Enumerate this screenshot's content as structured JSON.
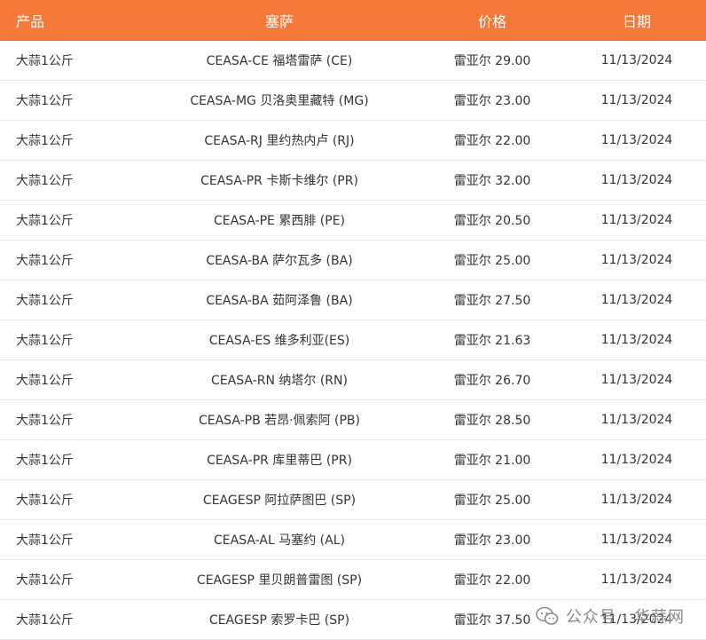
{
  "table": {
    "headers": [
      "产品",
      "塞萨",
      "价格",
      "日期"
    ],
    "rows": [
      [
        "大蒜1公斤",
        "CEASA-CE 福塔雷萨 (CE)",
        "雷亚尔 29.00",
        "11/13/2024"
      ],
      [
        "大蒜1公斤",
        "CEASA-MG 贝洛奥里藏特 (MG)",
        "雷亚尔 23.00",
        "11/13/2024"
      ],
      [
        "大蒜1公斤",
        "CEASA-RJ 里约热内卢 (RJ)",
        "雷亚尔 22.00",
        "11/13/2024"
      ],
      [
        "大蒜1公斤",
        "CEASA-PR 卡斯卡维尔 (PR)",
        "雷亚尔 32.00",
        "11/13/2024"
      ],
      [
        "大蒜1公斤",
        "CEASA-PE 累西腓 (PE)",
        "雷亚尔 20.50",
        "11/13/2024"
      ],
      [
        "大蒜1公斤",
        "CEASA-BA 萨尔瓦多 (BA)",
        "雷亚尔 25.00",
        "11/13/2024"
      ],
      [
        "大蒜1公斤",
        "CEASA-BA 茹阿泽鲁 (BA)",
        "雷亚尔 27.50",
        "11/13/2024"
      ],
      [
        "大蒜1公斤",
        "CEASA-ES 维多利亚(ES)",
        "雷亚尔 21.63",
        "11/13/2024"
      ],
      [
        "大蒜1公斤",
        "CEASA-RN 纳塔尔 (RN)",
        "雷亚尔 26.70",
        "11/13/2024"
      ],
      [
        "大蒜1公斤",
        "CEASA-PB 若昂·佩索阿 (PB)",
        "雷亚尔 28.50",
        "11/13/2024"
      ],
      [
        "大蒜1公斤",
        "CEASA-PR 库里蒂巴 (PR)",
        "雷亚尔 21.00",
        "11/13/2024"
      ],
      [
        "大蒜1公斤",
        "CEAGESP 阿拉萨图巴 (SP)",
        "雷亚尔 25.00",
        "11/13/2024"
      ],
      [
        "大蒜1公斤",
        "CEASA-AL 马塞约 (AL)",
        "雷亚尔 23.00",
        "11/13/2024"
      ],
      [
        "大蒜1公斤",
        "CEAGESP 里贝朗普雷图 (SP)",
        "雷亚尔 22.00",
        "11/13/2024"
      ],
      [
        "大蒜1公斤",
        "CEAGESP 索罗卡巴 (SP)",
        "雷亚尔 37.50",
        "11/13/2024"
      ]
    ]
  },
  "watermark": {
    "text": "公众号 · 华蒜网",
    "icon": "wechat-icon",
    "color": "#8a8a8a"
  },
  "colors": {
    "header_bg": "#f47836",
    "header_text": "#ffffff",
    "row_border": "#e8e8e8",
    "body_text": "#333333"
  }
}
